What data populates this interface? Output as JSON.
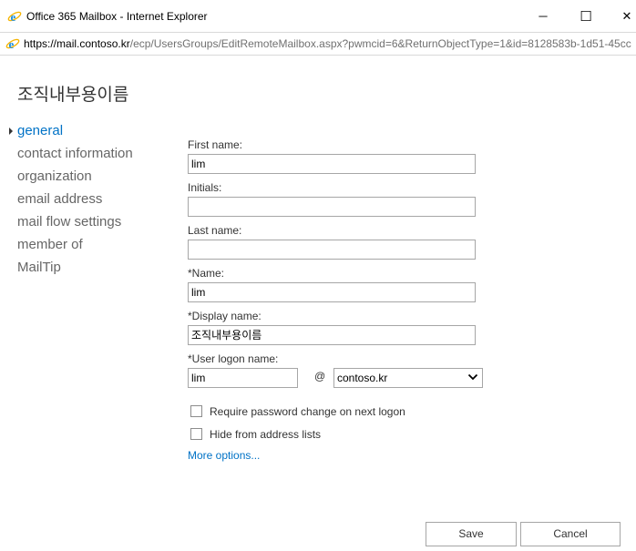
{
  "window": {
    "title": "Office 365 Mailbox - Internet Explorer",
    "minimize_glyph": "─",
    "maximize_glyph": "☐",
    "close_glyph": "✕"
  },
  "address": {
    "prefix": "https://",
    "host": "mail.contoso.kr",
    "path": "/ecp/UsersGroups/EditRemoteMailbox.aspx?pwmcid=6&ReturnObjectType=1&id=8128583b-1d51-45cc"
  },
  "page": {
    "title": "조직내부용이름"
  },
  "nav": {
    "items": [
      {
        "label": "general",
        "active": true
      },
      {
        "label": "contact information"
      },
      {
        "label": "organization"
      },
      {
        "label": "email address"
      },
      {
        "label": "mail flow settings"
      },
      {
        "label": "member of"
      },
      {
        "label": "MailTip"
      }
    ]
  },
  "form": {
    "first_name": {
      "label": "First name:",
      "value": "lim"
    },
    "initials": {
      "label": "Initials:",
      "value": ""
    },
    "last_name": {
      "label": "Last name:",
      "value": ""
    },
    "name": {
      "label": "*Name:",
      "value": "lim"
    },
    "display_name": {
      "label": "*Display name:",
      "value": "조직내부용이름"
    },
    "logon": {
      "label": "*User logon name:",
      "value": "lim",
      "at": "@",
      "domain": "contoso.kr"
    },
    "require_pw_change": {
      "label": "Require password change on next logon",
      "checked": false
    },
    "hide_from_lists": {
      "label": "Hide from address lists",
      "checked": false
    },
    "more_options": "More options..."
  },
  "buttons": {
    "save": "Save",
    "cancel": "Cancel"
  },
  "colors": {
    "accent": "#0072c6",
    "border": "#a6a6a6"
  },
  "icons": {
    "browser": "ie-icon",
    "dropdown": "chevron-down-icon"
  }
}
